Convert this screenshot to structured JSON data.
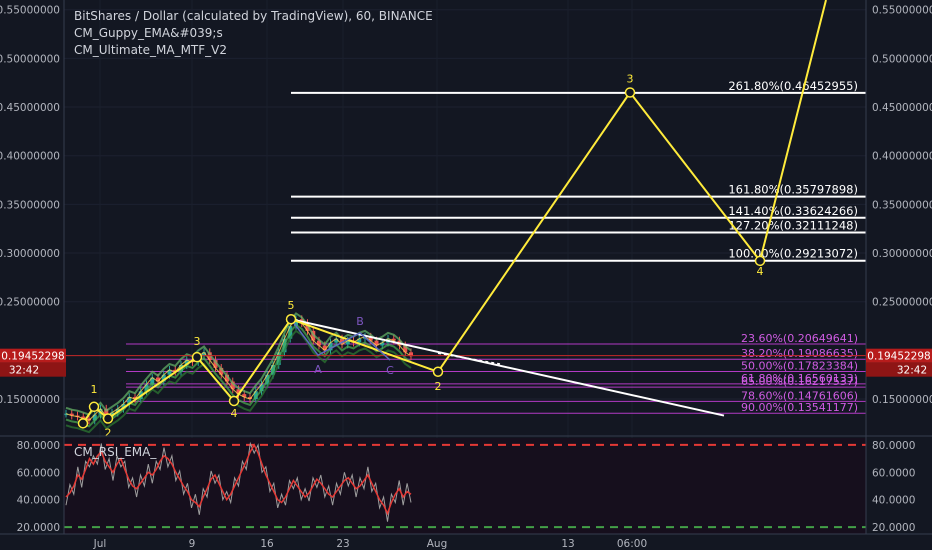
{
  "legend": {
    "title": "BitShares / Dollar (calculated by TradingView), 60, BINANCE",
    "indicator_1": "CM_Guppy_EMA&#039;s",
    "indicator_2": "CM_Ultimate_MA_MTF_V2"
  },
  "rsi_panel": {
    "title": "CM_RSI_EMA_",
    "ticks": [
      "80.0000",
      "60.0000",
      "40.0000",
      "20.0000"
    ],
    "tick_values": [
      80,
      60,
      40,
      20
    ],
    "ylim": [
      15,
      85
    ],
    "overbought": 80,
    "oversold": 20,
    "series": [
      42,
      45,
      50,
      58,
      55,
      62,
      70,
      66,
      72,
      75,
      68,
      64,
      60,
      66,
      70,
      62,
      55,
      50,
      48,
      52,
      56,
      60,
      58,
      62,
      68,
      72,
      70,
      66,
      60,
      55,
      50,
      46,
      40,
      38,
      35,
      42,
      48,
      55,
      58,
      52,
      46,
      40,
      44,
      50,
      56,
      62,
      68,
      75,
      80,
      74,
      66,
      58,
      52,
      46,
      40,
      38,
      42,
      48,
      54,
      50,
      46,
      42,
      45,
      50,
      55,
      52,
      48,
      44,
      42,
      46,
      50,
      54,
      56,
      52,
      48,
      50,
      54,
      58,
      52,
      46,
      40,
      36,
      30,
      38,
      44,
      48,
      42,
      46,
      44
    ]
  },
  "price_axis": {
    "ticks": [
      "0.55000000",
      "0.50000000",
      "0.45000000",
      "0.40000000",
      "0.35000000",
      "0.30000000",
      "0.25000000",
      "0.15000000"
    ],
    "tick_values": [
      0.55,
      0.5,
      0.45,
      0.4,
      0.35,
      0.3,
      0.25,
      0.15
    ],
    "current_price": "0.19452298",
    "current_value": 0.19452298,
    "countdown": "32:42"
  },
  "time_axis": {
    "ticks": [
      "Jul",
      "9",
      "16",
      "23",
      "Aug",
      "13",
      "06:00"
    ]
  },
  "chart_data": {
    "type": "line",
    "title": "BitShares / Dollar (calculated by TradingView), 60, BINANCE",
    "ylim": [
      0.112,
      0.56
    ],
    "price_series": [
      0.135,
      0.133,
      0.132,
      0.13,
      0.128,
      0.134,
      0.14,
      0.132,
      0.136,
      0.14,
      0.145,
      0.152,
      0.15,
      0.158,
      0.165,
      0.172,
      0.168,
      0.175,
      0.18,
      0.178,
      0.185,
      0.19,
      0.188,
      0.194,
      0.198,
      0.19,
      0.182,
      0.175,
      0.168,
      0.16,
      0.155,
      0.152,
      0.15,
      0.158,
      0.165,
      0.175,
      0.185,
      0.198,
      0.212,
      0.225,
      0.232,
      0.228,
      0.22,
      0.21,
      0.205,
      0.2,
      0.208,
      0.212,
      0.206,
      0.21,
      0.208,
      0.212,
      0.214,
      0.21,
      0.205,
      0.208,
      0.212,
      0.21,
      0.205,
      0.198,
      0.194
    ],
    "fib_retracement": [
      {
        "label": "23.60%(0.20649641)",
        "value": 0.20649641
      },
      {
        "label": "38.20%(0.19086635)",
        "value": 0.19086635
      },
      {
        "label": "50.00%(0.17823384)",
        "value": 0.17823384
      },
      {
        "label": "61.80%(0.16560133)",
        "value": 0.16560133
      },
      {
        "label": "65.00%(0.16217537)",
        "value": 0.16217537
      },
      {
        "label": "78.60%(0.14761606)",
        "value": 0.14761606
      },
      {
        "label": "90.00%(0.13541177)",
        "value": 0.13541177
      }
    ],
    "fib_extension": [
      {
        "label": "261.80%(0.46452955)",
        "value": 0.46452955
      },
      {
        "label": "161.80%(0.35797898)",
        "value": 0.35797898
      },
      {
        "label": "141.40%(0.33624266)",
        "value": 0.33624266
      },
      {
        "label": "127.20%(0.32111248)",
        "value": 0.32111248
      },
      {
        "label": "100.00%(0.29213072)",
        "value": 0.29213072
      }
    ],
    "wave_labels": [
      {
        "label": "1",
        "value": 0.142
      },
      {
        "label": "2",
        "value": 0.13
      },
      {
        "label": "3",
        "value": 0.193
      },
      {
        "label": "4",
        "value": 0.148
      },
      {
        "label": "5",
        "value": 0.232
      },
      {
        "label": "A",
        "value": 0.195
      },
      {
        "label": "B",
        "value": 0.218
      },
      {
        "label": "C",
        "value": 0.19
      },
      {
        "label": "2",
        "value": 0.178
      },
      {
        "label": "3",
        "value": 0.465
      },
      {
        "label": "4",
        "value": 0.292
      }
    ],
    "colors": {
      "background": "#131722",
      "wave": "#ffeb3b",
      "fib_retracement": "#b23ac4",
      "fib_extension": "#ffffff",
      "trendline": "#ffffff",
      "price_tag": "#b71c1c",
      "rsi_overbought": "#e53935",
      "rsi_oversold": "#43a047"
    }
  }
}
